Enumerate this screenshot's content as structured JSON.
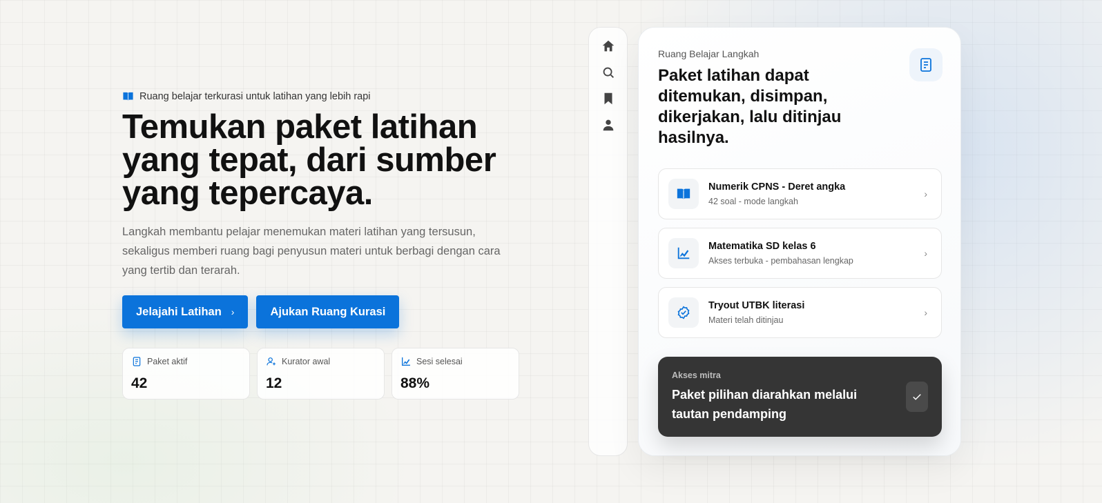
{
  "hero": {
    "eyebrow": "Ruang belajar terkurasi untuk latihan yang lebih rapi",
    "headline": "Temukan paket latihan yang tepat, dari sumber yang tepercaya.",
    "lead": "Langkah membantu pelajar menemukan materi latihan yang tersusun, sekaligus memberi ruang bagi penyusun materi untuk berbagi dengan cara yang tertib dan terarah.",
    "primary_button": "Jelajahi Latihan",
    "secondary_button": "Ajukan Ruang Kurasi"
  },
  "stats": [
    {
      "label": "Paket aktif",
      "value": "42",
      "icon": "receipt-icon"
    },
    {
      "label": "Kurator awal",
      "value": "12",
      "icon": "user-plus-icon"
    },
    {
      "label": "Sesi selesai",
      "value": "88%",
      "icon": "chart-icon"
    }
  ],
  "rail": {
    "icons": [
      "home-icon",
      "search-icon",
      "bookmark-icon",
      "user-icon"
    ]
  },
  "card": {
    "kicker": "Ruang Belajar Langkah",
    "title": "Paket latihan dapat ditemukan, disimpan, dikerjakan, lalu ditinjau hasilnya.",
    "badge_icon": "receipt-icon",
    "items": [
      {
        "title": "Numerik CPNS - Deret angka",
        "subtitle": "42 soal - mode langkah",
        "icon": "book-icon"
      },
      {
        "title": "Matematika SD kelas 6",
        "subtitle": "Akses terbuka - pembahasan lengkap",
        "icon": "chart-icon"
      },
      {
        "title": "Tryout UTBK literasi",
        "subtitle": "Materi telah ditinjau",
        "icon": "check-circle-icon"
      }
    ],
    "partner": {
      "kicker": "Akses mitra",
      "title": "Paket pilihan diarahkan melalui tautan pendamping"
    }
  },
  "colors": {
    "accent": "#0b73db",
    "dark_panel": "#353535",
    "background": "#f5f4f1"
  }
}
